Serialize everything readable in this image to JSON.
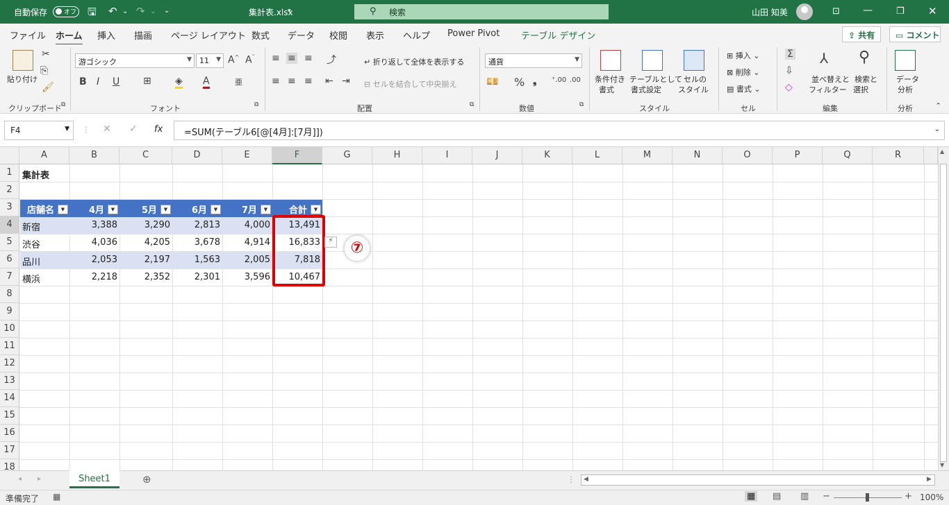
{
  "titlebar": {
    "autosave_label": "自動保存",
    "autosave_state": "オフ",
    "filename": "集計表.xlsx",
    "search_placeholder": "検索",
    "user_name": "山田 知美"
  },
  "tabs": [
    "ファイル",
    "ホーム",
    "挿入",
    "描画",
    "ページ レイアウト",
    "数式",
    "データ",
    "校閲",
    "表示",
    "ヘルプ",
    "Power Pivot",
    "テーブル デザイン"
  ],
  "active_tab": "ホーム",
  "share_label": "共有",
  "comment_label": "コメント",
  "ribbon": {
    "clipboard": {
      "paste": "貼り付け",
      "group": "クリップボード"
    },
    "font": {
      "name": "游ゴシック",
      "size": "11",
      "group": "フォント"
    },
    "alignment": {
      "wrap": "折り返して全体を表示する",
      "merge": "セルを結合して中央揃え",
      "group": "配置"
    },
    "number": {
      "format": "通貨",
      "group": "数値"
    },
    "styles": {
      "conditional_1": "条件付き",
      "conditional_2": "書式",
      "table_1": "テーブルとして",
      "table_2": "書式設定",
      "cell_1": "セルの",
      "cell_2": "スタイル",
      "group": "スタイル"
    },
    "cells": {
      "insert": "挿入",
      "delete": "削除",
      "format": "書式",
      "group": "セル"
    },
    "editing": {
      "sort_1": "並べ替えと",
      "sort_2": "フィルター",
      "find_1": "検索と",
      "find_2": "選択",
      "group": "編集"
    },
    "analysis": {
      "data_1": "データ",
      "data_2": "分析",
      "group": "分析"
    }
  },
  "namebox": "F4",
  "formula": "=SUM(テーブル6[@[4月]:[7月]])",
  "columns": [
    "A",
    "B",
    "C",
    "D",
    "E",
    "F",
    "G",
    "H",
    "I",
    "J",
    "K",
    "L",
    "M",
    "N",
    "O",
    "P",
    "Q",
    "R"
  ],
  "selected_column": "F",
  "rows": [
    "1",
    "2",
    "3",
    "4",
    "5",
    "6",
    "7",
    "8",
    "9",
    "10",
    "11",
    "12",
    "13",
    "14",
    "15",
    "16",
    "17",
    "18"
  ],
  "sheet": {
    "title": "集計表",
    "headers": [
      "店舗名",
      "4月",
      "5月",
      "6月",
      "7月",
      "合計"
    ],
    "data": [
      [
        "新宿",
        "3,388",
        "3,290",
        "2,813",
        "4,000",
        "13,491"
      ],
      [
        "渋谷",
        "4,036",
        "4,205",
        "3,678",
        "4,914",
        "16,833"
      ],
      [
        "品川",
        "2,053",
        "2,197",
        "1,563",
        "2,005",
        "7,818"
      ],
      [
        "横浜",
        "2,218",
        "2,352",
        "2,301",
        "3,596",
        "10,467"
      ]
    ]
  },
  "annotation_badge": "⑦",
  "sheet_tab": "Sheet1",
  "status": {
    "ready": "準備完了",
    "zoom": "100%"
  },
  "colors": {
    "excel_green": "#217346",
    "table_header": "#4472c4",
    "table_band": "#d9e1f2",
    "highlight": "#e00000"
  }
}
